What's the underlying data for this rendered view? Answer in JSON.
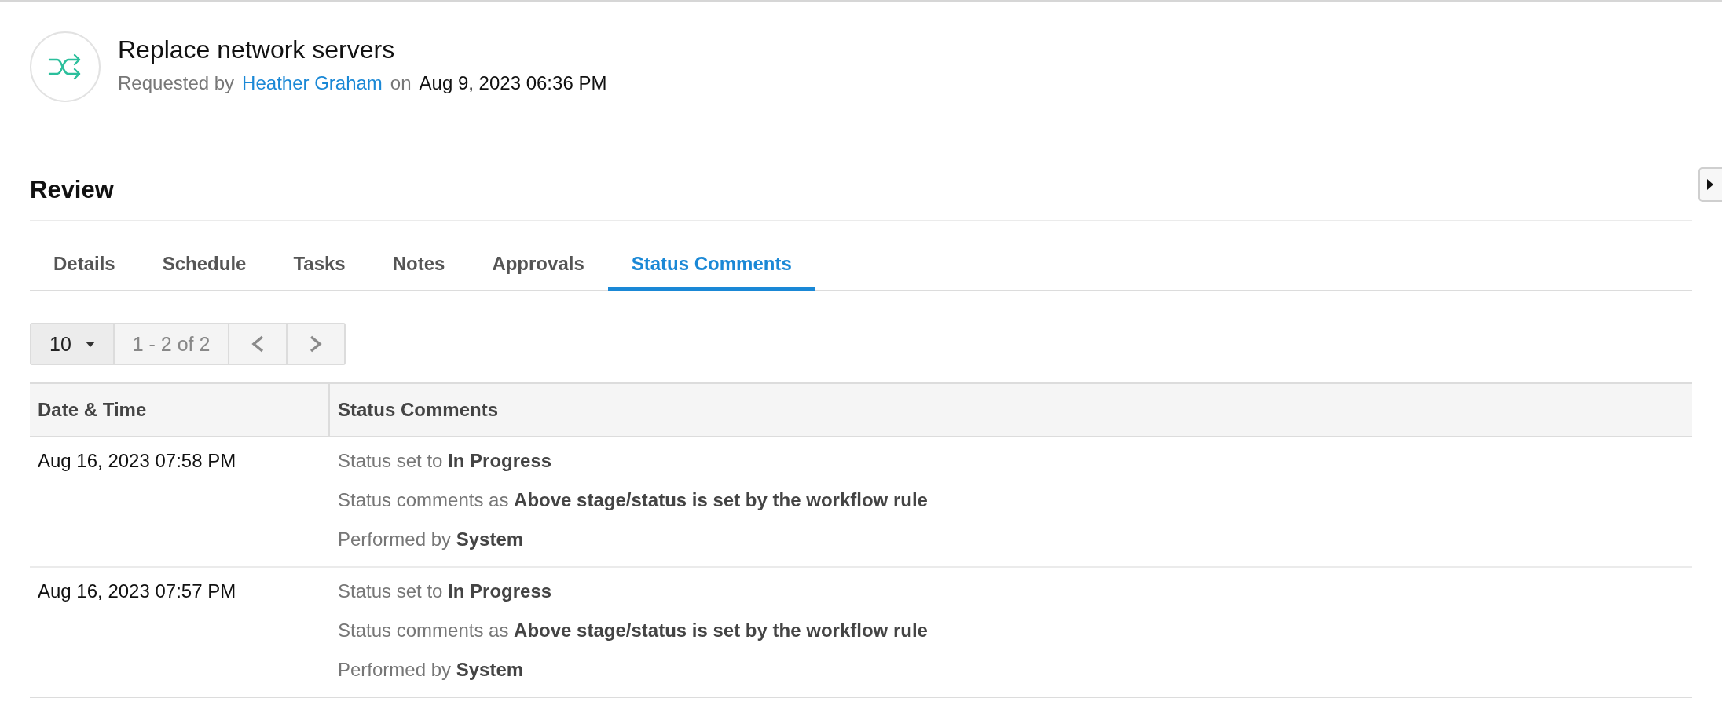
{
  "header": {
    "title": "Replace network servers",
    "requested_by_label": "Requested by",
    "requester": "Heather Graham",
    "on_label": "on",
    "requested_at": "Aug 9, 2023 06:36 PM"
  },
  "section": {
    "title": "Review"
  },
  "tabs": [
    {
      "label": "Details",
      "selected": false
    },
    {
      "label": "Schedule",
      "selected": false
    },
    {
      "label": "Tasks",
      "selected": false
    },
    {
      "label": "Notes",
      "selected": false
    },
    {
      "label": "Approvals",
      "selected": false
    },
    {
      "label": "Status Comments",
      "selected": true
    }
  ],
  "pager": {
    "page_size": "10",
    "range": "1 - 2 of 2"
  },
  "table": {
    "columns": [
      "Date & Time",
      "Status Comments"
    ],
    "rows": [
      {
        "date_time": "Aug 16, 2023 07:58 PM",
        "lines": [
          "Status set to **In Progress**",
          "Status comments as **Above stage/status is set by the workflow rule**",
          "Performed by **System**"
        ]
      },
      {
        "date_time": "Aug 16, 2023 07:57 PM",
        "lines": [
          "Status set to **In Progress**",
          "Status comments as **Above stage/status is set by the workflow rule**",
          "Performed by **System**"
        ]
      }
    ]
  }
}
